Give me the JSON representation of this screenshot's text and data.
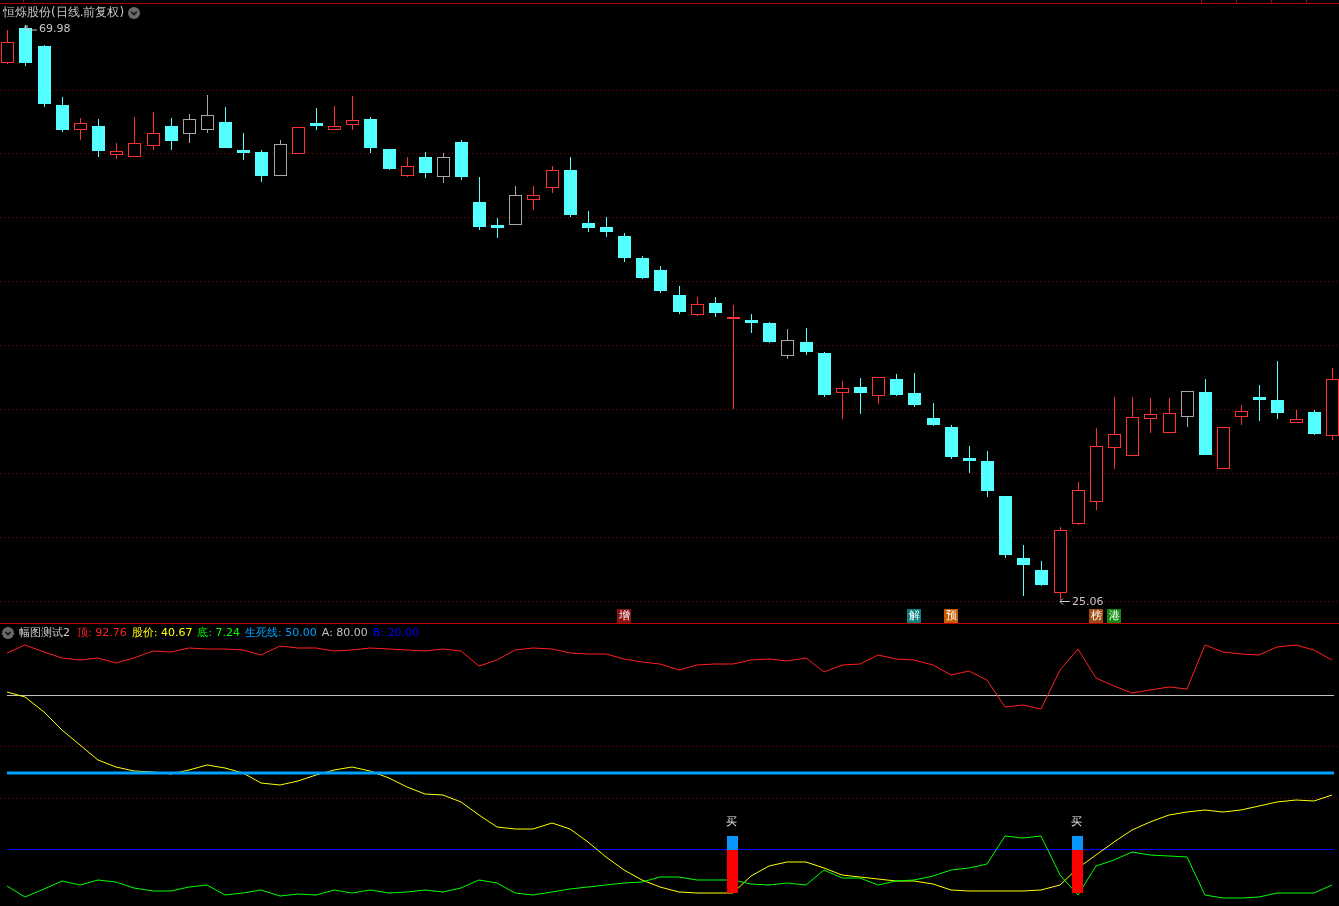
{
  "chart": {
    "title": "恒烁股份(日线.前复权)",
    "high_label": "69.98",
    "low_label": "25.06",
    "markers": [
      {
        "text": "增",
        "color": "#8b1010"
      },
      {
        "text": "解",
        "color": "#0a8080"
      },
      {
        "text": "预",
        "color": "#c85a00"
      },
      {
        "text": "榜",
        "color": "#a04a10"
      },
      {
        "text": "港",
        "color": "#108a10"
      }
    ]
  },
  "indicator": {
    "name": "幅图测试2",
    "legend": [
      {
        "text": "顶: 92.76",
        "color": "#ff2020"
      },
      {
        "text": "股价: 40.67",
        "color": "#ffff00"
      },
      {
        "text": "底: 7.24",
        "color": "#00ff00"
      },
      {
        "text": "生死线: 50.00",
        "color": "#00a0ff"
      },
      {
        "text": "A: 80.00",
        "color": "#c0c0c0"
      },
      {
        "text": "B: 20.00",
        "color": "#0000ff"
      }
    ],
    "signals": [
      {
        "label": "买"
      },
      {
        "label": "买"
      }
    ]
  }
}
